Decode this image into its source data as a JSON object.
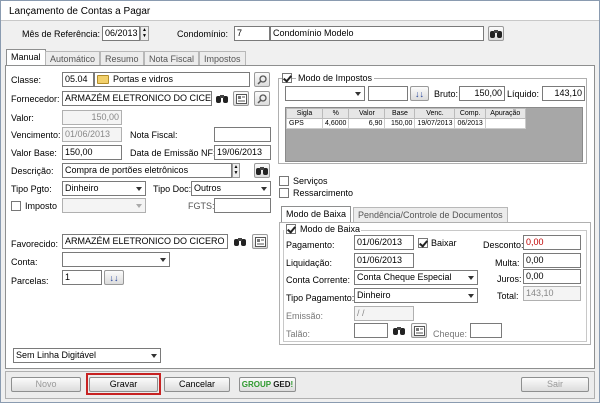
{
  "window": {
    "title": "Lançamento de Contas a Pagar"
  },
  "header": {
    "mes_label": "Mês de Referência:",
    "mes_value": "06/2013",
    "condominio_label": "Condomínio:",
    "condominio_code": "7",
    "condominio_name": "Condomínio Modelo"
  },
  "tabs": [
    "Manual",
    "Automático",
    "Resumo",
    "Nota Fiscal",
    "Impostos"
  ],
  "left": {
    "classe_label": "Classe:",
    "classe_code": "05.04",
    "classe_name": "Portas e vidros",
    "fornecedor_label": "Fornecedor:",
    "fornecedor_value": "ARMAZÉM ELETRONICO DO CICERO",
    "valor_label": "Valor:",
    "valor_value": "150,00",
    "vencimento_label": "Vencimento:",
    "vencimento_value": "01/06/2013",
    "nota_fiscal_label": "Nota Fiscal:",
    "nota_fiscal_value": "",
    "valor_base_label": "Valor Base:",
    "valor_base_value": "150,00",
    "data_emissao_label": "Data de Emissão NF:",
    "data_emissao_value": "19/06/2013",
    "descricao_label": "Descrição:",
    "descricao_value": "Compra de portões eletrônicos",
    "tipo_pgto_label": "Tipo Pgto:",
    "tipo_pgto_value": "Dinheiro",
    "tipo_doc_label": "Tipo Doc:",
    "tipo_doc_value": "Outros",
    "imposto_label": "Imposto",
    "imposto_value": "",
    "fgts_label": "FGTS:",
    "fgts_value": "",
    "favorecido_label": "Favorecido:",
    "favorecido_value": "ARMAZÉM ELETRONICO DO CICERO",
    "conta_label": "Conta:",
    "conta_value": "",
    "parcelas_label": "Parcelas:",
    "parcelas_value": "1",
    "linha_digitavel_value": "Sem Linha Digitável"
  },
  "impostos": {
    "modo_label": "Modo de Impostos",
    "modo_checked": true,
    "bruto_label": "Bruto:",
    "bruto_value": "150,00",
    "liquido_label": "Líquido:",
    "liquido_value": "143,10",
    "columns": [
      "Sigla",
      "%",
      "Valor",
      "Base",
      "Venc.",
      "Comp.",
      "Apuração"
    ],
    "rows": [
      [
        "GPS",
        "4,6000",
        "6,90",
        "150,00",
        "19/07/2013",
        "06/2013",
        ""
      ]
    ]
  },
  "options": {
    "servicos_label": "Serviços",
    "ressarcimento_label": "Ressarcimento"
  },
  "baixa": {
    "tabs": [
      "Modo de Baixa",
      "Pendência/Controle de Documentos"
    ],
    "modo_label": "Modo de Baixa",
    "modo_checked": true,
    "pagamento_label": "Pagamento:",
    "pagamento_value": "01/06/2013",
    "baixar_label": "Baixar",
    "baixar_checked": true,
    "desconto_label": "Desconto:",
    "desconto_value": "0,00",
    "liquidacao_label": "Liquidação:",
    "liquidacao_value": "01/06/2013",
    "multa_label": "Multa:",
    "multa_value": "0,00",
    "conta_corrente_label": "Conta Corrente:",
    "conta_corrente_value": "Conta Cheque Especial",
    "juros_label": "Juros:",
    "juros_value": "0,00",
    "tipo_pagamento_label": "Tipo Pagamento:",
    "tipo_pagamento_value": "Dinheiro",
    "total_label": "Total:",
    "total_value": "143,10",
    "emissao_label": "Emissão:",
    "emissao_value": "/ /",
    "talao_label": "Talão:",
    "talao_value": "",
    "cheque_label": "Cheque:",
    "cheque_value": ""
  },
  "footer": {
    "novo": "Novo",
    "gravar": "Gravar",
    "cancelar": "Cancelar",
    "ged_group": "GROUP",
    "ged_ged": "GED",
    "sair": "Sair"
  },
  "colors": {
    "highlight": "#c00000",
    "ged_green": "#2e9a2e"
  }
}
